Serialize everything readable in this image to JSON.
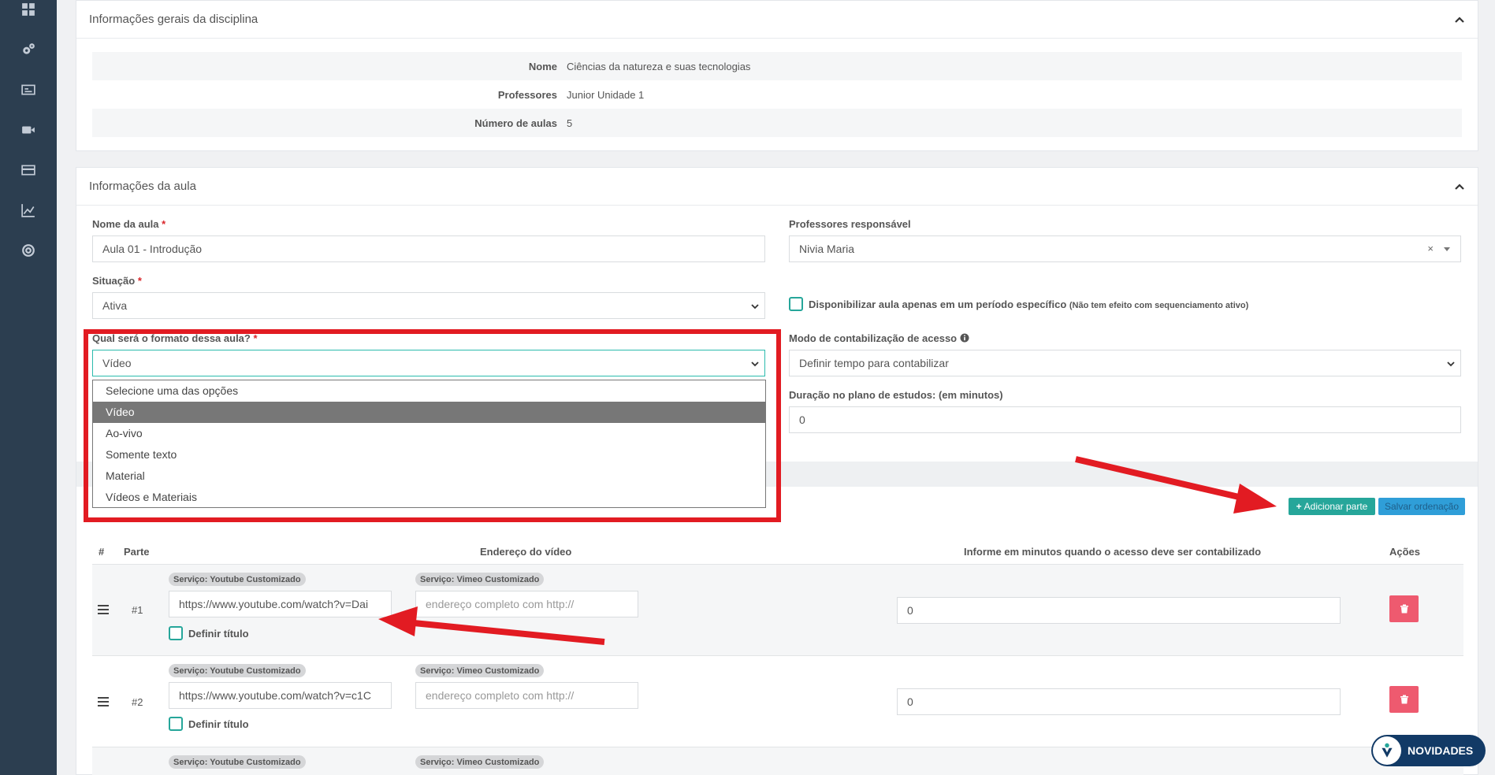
{
  "sidebar": {
    "items": [
      {
        "icon": "dashboard-icon"
      },
      {
        "icon": "gears-icon"
      },
      {
        "icon": "id-card-icon"
      },
      {
        "icon": "video-camera-icon"
      },
      {
        "icon": "credit-card-icon"
      },
      {
        "icon": "line-chart-icon"
      },
      {
        "icon": "lifebuoy-icon"
      }
    ]
  },
  "discipline": {
    "title": "Informações gerais da disciplina",
    "rows": [
      {
        "label": "Nome",
        "value": "Ciências da natureza e suas tecnologias"
      },
      {
        "label": "Professores",
        "value": "Junior Unidade 1"
      },
      {
        "label": "Número de aulas",
        "value": "5"
      }
    ]
  },
  "lesson": {
    "title": "Informações da aula",
    "name_label": "Nome da aula",
    "name_value": "Aula 01 - Introdução",
    "teachers_label": "Professores responsável",
    "teachers_value": "Nivia Maria",
    "teachers_clear": "×",
    "status_label": "Situação",
    "status_value": "Ativa",
    "period_check_label": "Disponibilizar aula apenas em um período específico",
    "period_check_note": "(Não tem efeito com sequenciamento ativo)",
    "format_label": "Qual será o formato dessa aula?",
    "format_value": "Vídeo",
    "format_options": [
      "Selecione uma das opções",
      "Vídeo",
      "Ao-vivo",
      "Somente texto",
      "Material",
      "Vídeos e Materiais"
    ],
    "format_selected_index": 1,
    "access_mode_label": "Modo de contabilização de acesso",
    "access_mode_value": "Definir tempo para contabilizar",
    "duration_label": "Duração no plano de estudos: (em minutos)",
    "duration_value": "0",
    "required_mark": "*"
  },
  "parts": {
    "add_button": "Adicionar parte",
    "add_icon": "+",
    "save_order_button": "Salvar ordenação",
    "columns": [
      "#",
      "Parte",
      "Endereço do vídeo",
      "Informe em minutos quando o acesso deve ser contabilizado",
      "Ações"
    ],
    "badge_youtube": "Serviço: Youtube Customizado",
    "badge_vimeo": "Serviço: Vimeo Customizado",
    "vimeo_placeholder": "endereço completo com http://",
    "define_title_label": "Definir título",
    "rows": [
      {
        "number": "#1",
        "youtube_url": "https://www.youtube.com/watch?v=Dai",
        "minutes": "0"
      },
      {
        "number": "#2",
        "youtube_url": "https://www.youtube.com/watch?v=c1C",
        "minutes": "0"
      }
    ]
  },
  "novidades": {
    "label": "NOVIDADES"
  },
  "colors": {
    "sidebar": "#2c3e50",
    "accent": "#26a69a",
    "danger": "#ee5a6f",
    "highlight": "#e21b22",
    "selected_option": "#777777"
  }
}
